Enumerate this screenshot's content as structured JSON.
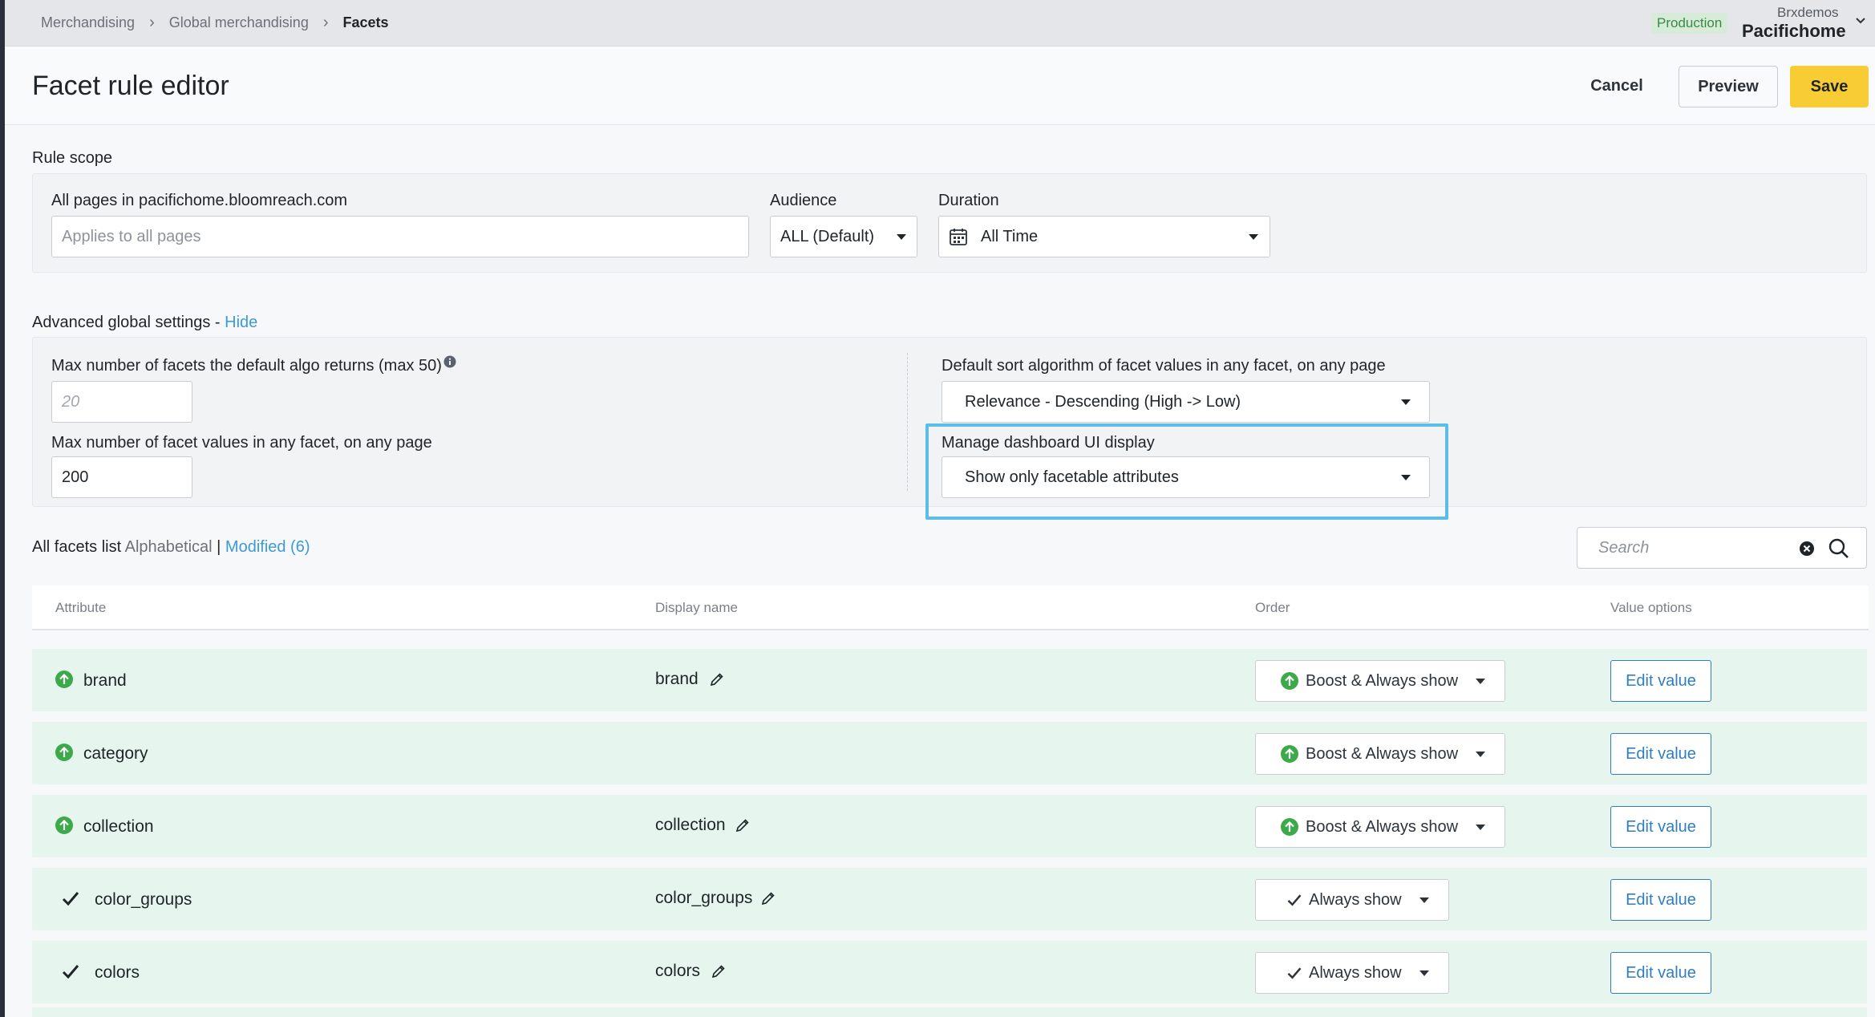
{
  "breadcrumb": {
    "items": [
      "Merchandising",
      "Global merchandising"
    ],
    "current": "Facets",
    "separator": "›"
  },
  "account": {
    "environment": "Production",
    "org": "Brxdemos",
    "name": "Pacifichome"
  },
  "header": {
    "title": "Facet rule editor",
    "cancel_label": "Cancel",
    "preview_label": "Preview",
    "save_label": "Save"
  },
  "rule_scope": {
    "section_label": "Rule scope",
    "pages_label": "All pages in pacifichome.bloomreach.com",
    "pages_placeholder": "Applies to all pages",
    "audience_label": "Audience",
    "audience_value": "ALL (Default)",
    "duration_label": "Duration",
    "duration_value": "All Time"
  },
  "advanced": {
    "section_label": "Advanced global settings -",
    "toggle_label": "Hide",
    "max_facets_label": "Max number of facets the default algo returns (max 50)",
    "max_facets_placeholder": "20",
    "max_values_label": "Max number of facet values in any facet, on any page",
    "max_values_value": "200",
    "sort_label": "Default sort algorithm of facet values in any facet, on any page",
    "sort_value": "Relevance - Descending (High -> Low)",
    "display_label": "Manage dashboard UI display",
    "display_value": "Show only facetable attributes"
  },
  "facets_list": {
    "label": "All facets list",
    "sort_alpha": "Alphabetical",
    "divider": "|",
    "sort_modified": "Modified (6)",
    "search_placeholder": "Search"
  },
  "table": {
    "columns": [
      "Attribute",
      "Display name",
      "Order",
      "Value options"
    ],
    "rows": [
      {
        "status": "boost",
        "attribute": "brand",
        "display_name": "brand",
        "order": "Boost & Always show",
        "action": "Edit value"
      },
      {
        "status": "boost",
        "attribute": "category",
        "display_name": "",
        "order": "Boost & Always show",
        "action": "Edit value"
      },
      {
        "status": "boost",
        "attribute": "collection",
        "display_name": "collection",
        "order": "Boost & Always show",
        "action": "Edit value"
      },
      {
        "status": "check",
        "attribute": "color_groups",
        "display_name": "color_groups",
        "order": "Always show",
        "action": "Edit value"
      },
      {
        "status": "check",
        "attribute": "colors",
        "display_name": "colors",
        "order": "Always show",
        "action": "Edit value"
      }
    ]
  },
  "colors": {
    "accent_yellow": "#f7cc34",
    "link_blue": "#3d9ad6",
    "row_green": "#e6f6ef",
    "boost_green": "#3daa4a",
    "highlight": "#5bbde8"
  }
}
